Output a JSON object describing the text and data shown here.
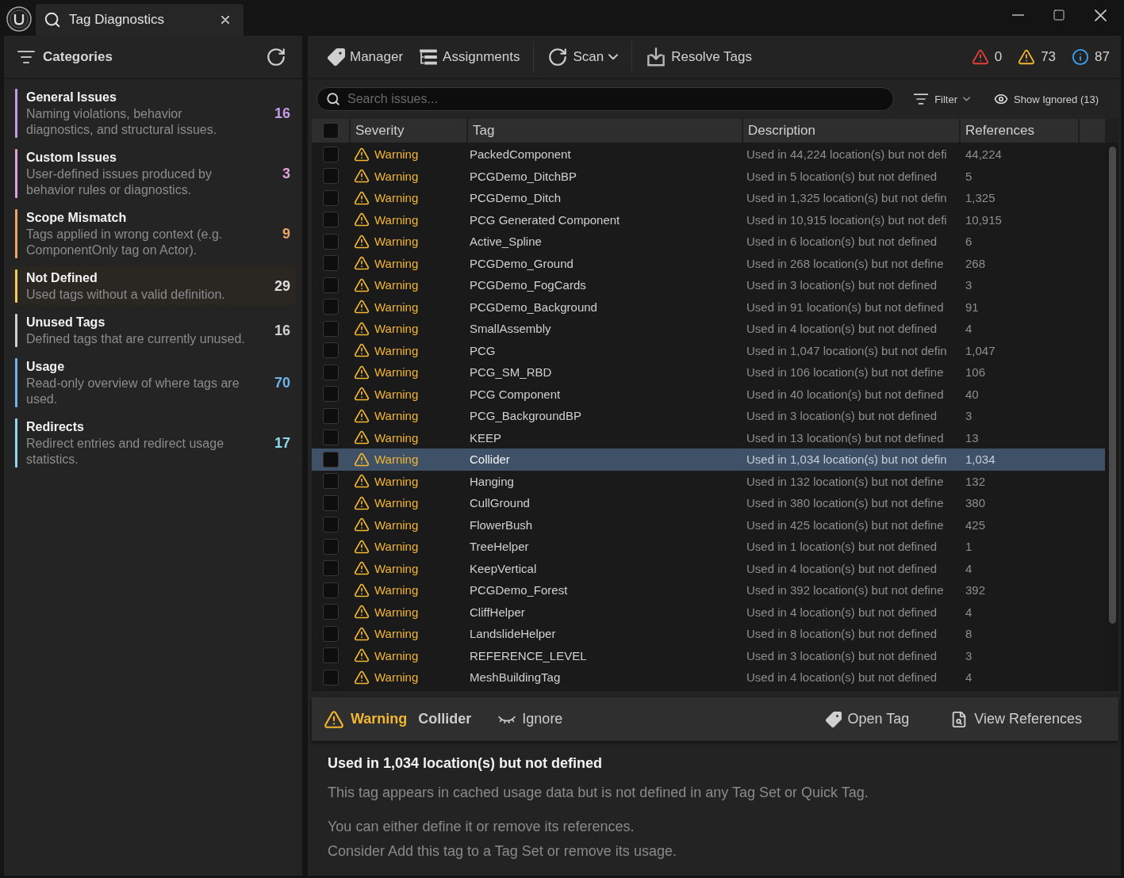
{
  "window": {
    "title": "Tag Diagnostics"
  },
  "sidebar": {
    "title": "Categories",
    "categories": [
      {
        "title": "General Issues",
        "description": "Naming violations, behavior diagnostics, and structural issues.",
        "count": "16",
        "color": "#c39be6",
        "selected": false
      },
      {
        "title": "Custom Issues",
        "description": "User-defined issues produced by behavior rules or diagnostics.",
        "count": "3",
        "color": "#e2a0dc",
        "selected": false
      },
      {
        "title": "Scope Mismatch",
        "description": "Tags applied in wrong context (e.g. ComponentOnly tag on Actor).",
        "count": "9",
        "color": "#eba567",
        "selected": false
      },
      {
        "title": "Not Defined",
        "description": "Used tags without a valid definition.",
        "count": "29",
        "color": "#f2cf5b",
        "selected": true
      },
      {
        "title": "Unused Tags",
        "description": "Defined tags that are currently unused.",
        "count": "16",
        "color": "#cfcfcf",
        "selected": false
      },
      {
        "title": "Usage",
        "description": "Read-only overview of where tags are used.",
        "count": "70",
        "color": "#6fb4e8",
        "selected": false
      },
      {
        "title": "Redirects",
        "description": "Redirect entries and redirect usage statistics.",
        "count": "17",
        "color": "#8fd6ef",
        "selected": false
      }
    ]
  },
  "toolbar": {
    "groups": [
      [
        {
          "label": "Manager",
          "kind": "tag",
          "dropdown": false
        },
        {
          "label": "Assignments",
          "kind": "list",
          "dropdown": false
        }
      ],
      [
        {
          "label": "Scan",
          "kind": "refresh",
          "dropdown": true
        }
      ],
      [
        {
          "label": "Resolve Tags",
          "kind": "import",
          "dropdown": false
        }
      ]
    ],
    "counters": [
      {
        "kind": "error",
        "count": "0"
      },
      {
        "kind": "warning",
        "count": "73"
      },
      {
        "kind": "info",
        "count": "87"
      }
    ]
  },
  "search": {
    "placeholder": "Search issues..."
  },
  "filter": {
    "label": "Filter"
  },
  "show_ignored": {
    "label": "Show Ignored (13)"
  },
  "table": {
    "all_checked": false,
    "columns": [
      "Severity",
      "Tag",
      "Description",
      "References"
    ],
    "rows": [
      {
        "checked": false,
        "selected": false,
        "severity": "Warning",
        "tag": "PackedComponent",
        "description": "Used in 44,224 location(s) but not defi",
        "references": "44,224"
      },
      {
        "checked": false,
        "selected": false,
        "severity": "Warning",
        "tag": "PCGDemo_DitchBP",
        "description": "Used in 5 location(s) but not defined",
        "references": "5"
      },
      {
        "checked": false,
        "selected": false,
        "severity": "Warning",
        "tag": "PCGDemo_Ditch",
        "description": "Used in 1,325 location(s) but not defin",
        "references": "1,325"
      },
      {
        "checked": false,
        "selected": false,
        "severity": "Warning",
        "tag": "PCG Generated Component",
        "description": "Used in 10,915 location(s) but not defi",
        "references": "10,915"
      },
      {
        "checked": false,
        "selected": false,
        "severity": "Warning",
        "tag": "Active_Spline",
        "description": "Used in 6 location(s) but not defined",
        "references": "6"
      },
      {
        "checked": false,
        "selected": false,
        "severity": "Warning",
        "tag": "PCGDemo_Ground",
        "description": "Used in 268 location(s) but not define",
        "references": "268"
      },
      {
        "checked": false,
        "selected": false,
        "severity": "Warning",
        "tag": "PCGDemo_FogCards",
        "description": "Used in 3 location(s) but not defined",
        "references": "3"
      },
      {
        "checked": false,
        "selected": false,
        "severity": "Warning",
        "tag": "PCGDemo_Background",
        "description": "Used in 91 location(s) but not defined",
        "references": "91"
      },
      {
        "checked": false,
        "selected": false,
        "severity": "Warning",
        "tag": "SmallAssembly",
        "description": "Used in 4 location(s) but not defined",
        "references": "4"
      },
      {
        "checked": false,
        "selected": false,
        "severity": "Warning",
        "tag": "PCG",
        "description": "Used in 1,047 location(s) but not defin",
        "references": "1,047"
      },
      {
        "checked": false,
        "selected": false,
        "severity": "Warning",
        "tag": "PCG_SM_RBD",
        "description": "Used in 106 location(s) but not define",
        "references": "106"
      },
      {
        "checked": false,
        "selected": false,
        "severity": "Warning",
        "tag": "PCG Component",
        "description": "Used in 40 location(s) but not defined",
        "references": "40"
      },
      {
        "checked": false,
        "selected": false,
        "severity": "Warning",
        "tag": "PCG_BackgroundBP",
        "description": "Used in 3 location(s) but not defined",
        "references": "3"
      },
      {
        "checked": false,
        "selected": false,
        "severity": "Warning",
        "tag": "KEEP",
        "description": "Used in 13 location(s) but not defined",
        "references": "13"
      },
      {
        "checked": false,
        "selected": true,
        "severity": "Warning",
        "tag": "Collider",
        "description": "Used in 1,034 location(s) but not defin",
        "references": "1,034"
      },
      {
        "checked": false,
        "selected": false,
        "severity": "Warning",
        "tag": "Hanging",
        "description": "Used in 132 location(s) but not define",
        "references": "132"
      },
      {
        "checked": false,
        "selected": false,
        "severity": "Warning",
        "tag": "CullGround",
        "description": "Used in 380 location(s) but not define",
        "references": "380"
      },
      {
        "checked": false,
        "selected": false,
        "severity": "Warning",
        "tag": "FlowerBush",
        "description": "Used in 425 location(s) but not define",
        "references": "425"
      },
      {
        "checked": false,
        "selected": false,
        "severity": "Warning",
        "tag": "TreeHelper",
        "description": "Used in 1 location(s) but not defined",
        "references": "1"
      },
      {
        "checked": false,
        "selected": false,
        "severity": "Warning",
        "tag": "KeepVertical",
        "description": "Used in 4 location(s) but not defined",
        "references": "4"
      },
      {
        "checked": false,
        "selected": false,
        "severity": "Warning",
        "tag": "PCGDemo_Forest",
        "description": "Used in 392 location(s) but not define",
        "references": "392"
      },
      {
        "checked": false,
        "selected": false,
        "severity": "Warning",
        "tag": "CliffHelper",
        "description": "Used in 4 location(s) but not defined",
        "references": "4"
      },
      {
        "checked": false,
        "selected": false,
        "severity": "Warning",
        "tag": "LandslideHelper",
        "description": "Used in 8 location(s) but not defined",
        "references": "8"
      },
      {
        "checked": false,
        "selected": false,
        "severity": "Warning",
        "tag": "REFERENCE_LEVEL",
        "description": "Used in 3 location(s) but not defined",
        "references": "3"
      },
      {
        "checked": false,
        "selected": false,
        "severity": "Warning",
        "tag": "MeshBuildingTag",
        "description": "Used in 4 location(s) but not defined",
        "references": "4"
      }
    ]
  },
  "detail": {
    "severity": "Warning",
    "tag": "Collider",
    "actions": [
      {
        "label": "Ignore",
        "kind": "ignore"
      }
    ],
    "links": [
      {
        "label": "Open Tag",
        "kind": "tag"
      },
      {
        "label": "View References",
        "kind": "references"
      }
    ],
    "title": "Used in 1,034 location(s) but not defined",
    "explanation": "This tag appears in cached usage data but is not defined in any Tag Set or Quick Tag.",
    "suggestions": [
      "You can either define it or remove its references.",
      "Consider Add this tag to a Tag Set or remove its usage."
    ]
  }
}
